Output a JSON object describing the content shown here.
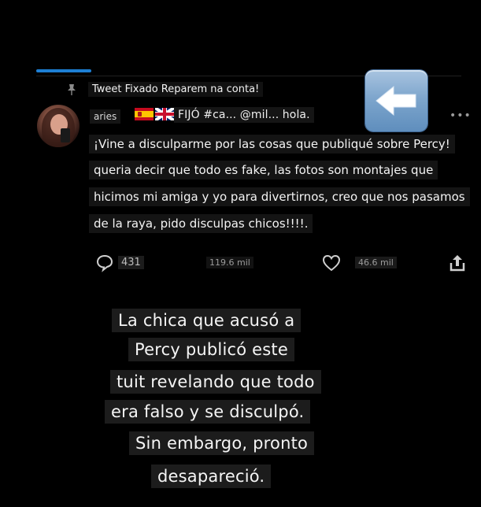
{
  "pinned_label": "Tweet Fixado Reparem na conta!",
  "profile": {
    "handle": "aries",
    "meta": "FIJÓ #ca... @mil... hola."
  },
  "tweet": {
    "lines": [
      "¡Vine a disculparme por las cosas que publiqué sobre Percy!",
      "queria decir que todo es fake, las fotos son montajes que",
      "hicimos mi amiga y yo para divertirnos, creo que nos pasamos",
      "de la raya, pido disculpas chicos!!!!."
    ]
  },
  "actions": {
    "replies": "431",
    "retweets": "119.6 mil",
    "likes": "46.6 mil"
  },
  "caption": {
    "lines": [
      "La chica que acusó a",
      "Percy publicó este",
      "tuit revelando que todo",
      "era falso y se disculpó.",
      "Sin embargo, pronto",
      "desapareció."
    ]
  },
  "icons": [
    "pin-icon",
    "spain-flag-icon",
    "uk-flag-icon",
    "back-arrow-icon",
    "more-icon",
    "reply-icon",
    "like-icon",
    "share-icon"
  ],
  "colors": {
    "background": "#000000",
    "accent": "#1d7fd4",
    "back_button": "#7ea6cd"
  }
}
